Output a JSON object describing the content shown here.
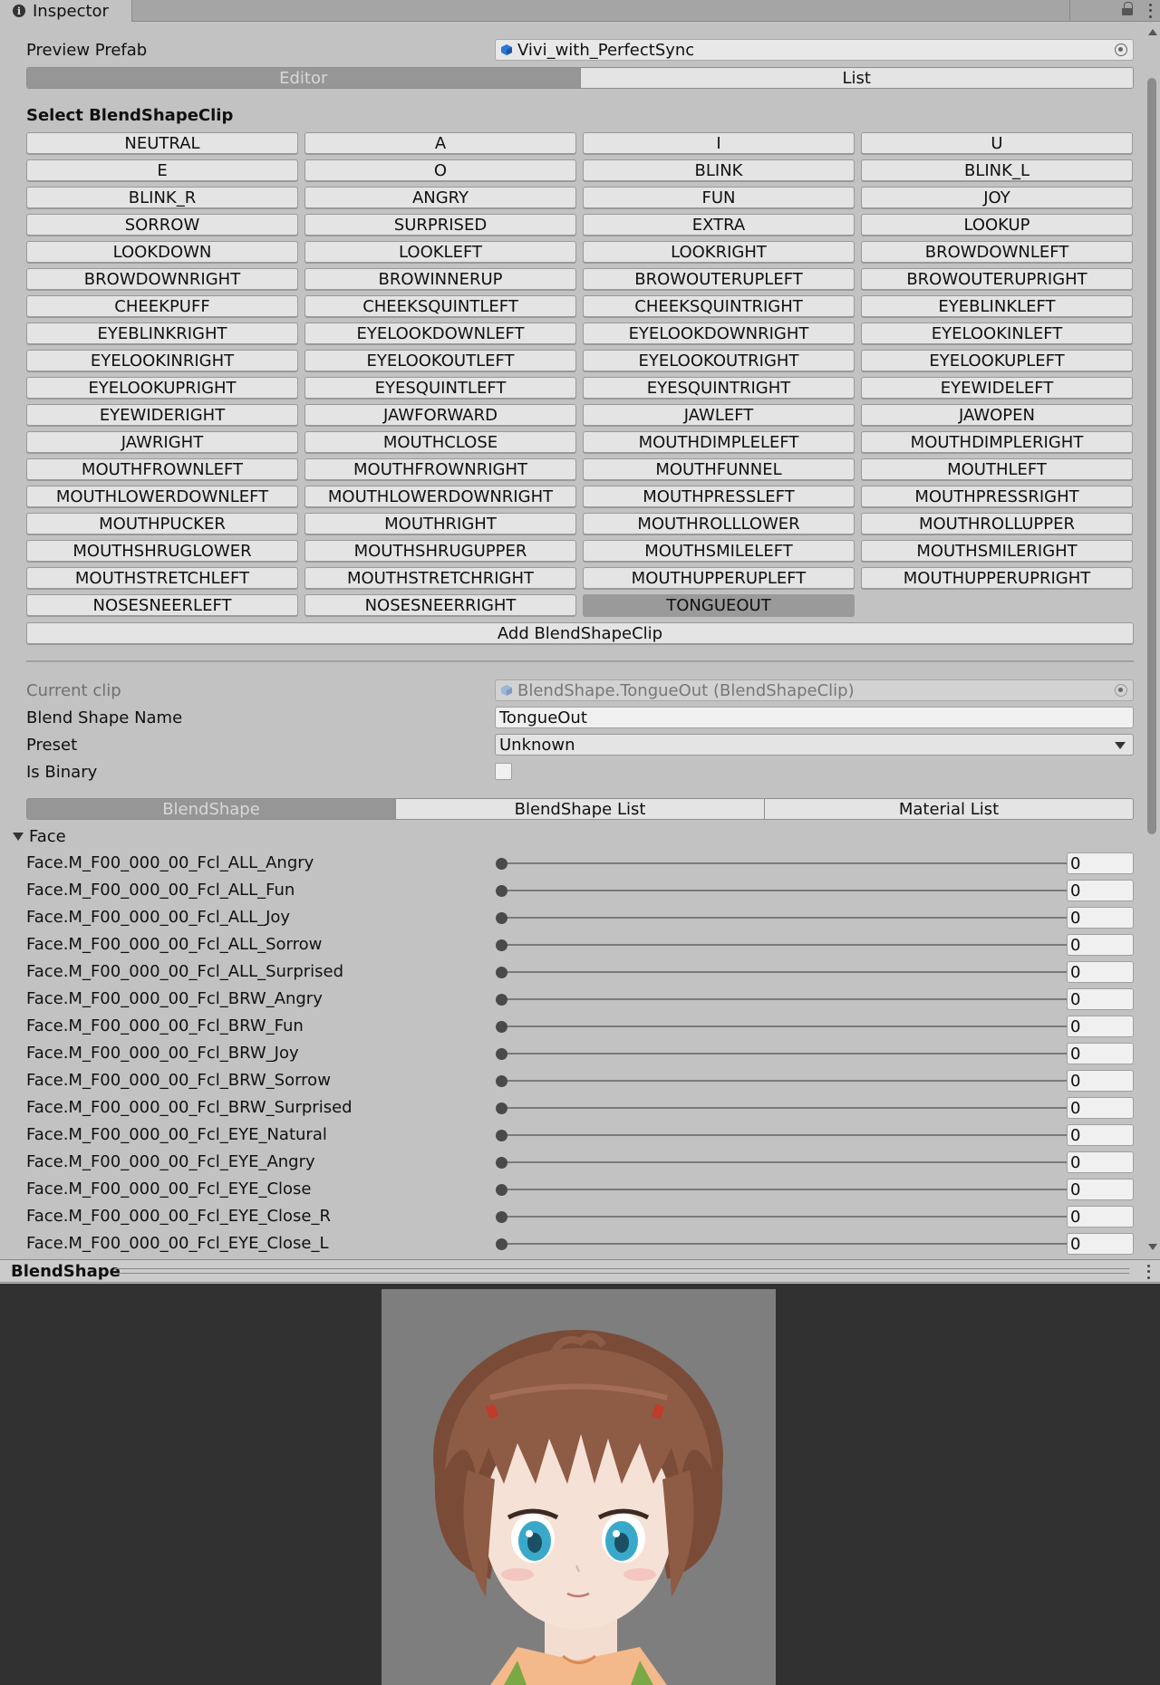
{
  "window": {
    "tab_label": "Inspector",
    "tab_icon": "info-icon"
  },
  "header": {
    "preview_prefab_label": "Preview Prefab",
    "preview_prefab_value": "Vivi_with_PerfectSync",
    "mode_tabs": [
      "Editor",
      "List"
    ],
    "active_mode": "Editor"
  },
  "clips": {
    "title": "Select BlendShapeClip",
    "items": [
      "NEUTRAL",
      "A",
      "I",
      "U",
      "E",
      "O",
      "BLINK",
      "BLINK_L",
      "BLINK_R",
      "ANGRY",
      "FUN",
      "JOY",
      "SORROW",
      "SURPRISED",
      "EXTRA",
      "LOOKUP",
      "LOOKDOWN",
      "LOOKLEFT",
      "LOOKRIGHT",
      "BROWDOWNLEFT",
      "BROWDOWNRIGHT",
      "BROWINNERUP",
      "BROWOUTERUPLEFT",
      "BROWOUTERUPRIGHT",
      "CHEEKPUFF",
      "CHEEKSQUINTLEFT",
      "CHEEKSQUINTRIGHT",
      "EYEBLINKLEFT",
      "EYEBLINKRIGHT",
      "EYELOOKDOWNLEFT",
      "EYELOOKDOWNRIGHT",
      "EYELOOKINLEFT",
      "EYELOOKINRIGHT",
      "EYELOOKOUTLEFT",
      "EYELOOKOUTRIGHT",
      "EYELOOKUPLEFT",
      "EYELOOKUPRIGHT",
      "EYESQUINTLEFT",
      "EYESQUINTRIGHT",
      "EYEWIDELEFT",
      "EYEWIDERIGHT",
      "JAWFORWARD",
      "JAWLEFT",
      "JAWOPEN",
      "JAWRIGHT",
      "MOUTHCLOSE",
      "MOUTHDIMPLELEFT",
      "MOUTHDIMPLERIGHT",
      "MOUTHFROWNLEFT",
      "MOUTHFROWNRIGHT",
      "MOUTHFUNNEL",
      "MOUTHLEFT",
      "MOUTHLOWERDOWNLEFT",
      "MOUTHLOWERDOWNRIGHT",
      "MOUTHPRESSLEFT",
      "MOUTHPRESSRIGHT",
      "MOUTHPUCKER",
      "MOUTHRIGHT",
      "MOUTHROLLLOWER",
      "MOUTHROLLUPPER",
      "MOUTHSHRUGLOWER",
      "MOUTHSHRUGUPPER",
      "MOUTHSMILELEFT",
      "MOUTHSMILERIGHT",
      "MOUTHSTRETCHLEFT",
      "MOUTHSTRETCHRIGHT",
      "MOUTHUPPERUPLEFT",
      "MOUTHUPPERUPRIGHT",
      "NOSESNEERLEFT",
      "NOSESNEERRIGHT",
      "TONGUEOUT"
    ],
    "selected": "TONGUEOUT",
    "add_label": "Add BlendShapeClip"
  },
  "clip_props": {
    "current_clip_label": "Current clip",
    "current_clip_value": "BlendShape.TongueOut (BlendShapeClip)",
    "name_label": "Blend Shape Name",
    "name_value": "TongueOut",
    "preset_label": "Preset",
    "preset_value": "Unknown",
    "is_binary_label": "Is Binary",
    "is_binary": false
  },
  "sub_tabs": {
    "items": [
      "BlendShape",
      "BlendShape List",
      "Material List"
    ],
    "active": "BlendShape"
  },
  "face": {
    "foldout_label": "Face",
    "sliders": [
      {
        "name": "Face.M_F00_000_00_Fcl_ALL_Angry",
        "value": 0
      },
      {
        "name": "Face.M_F00_000_00_Fcl_ALL_Fun",
        "value": 0
      },
      {
        "name": "Face.M_F00_000_00_Fcl_ALL_Joy",
        "value": 0
      },
      {
        "name": "Face.M_F00_000_00_Fcl_ALL_Sorrow",
        "value": 0
      },
      {
        "name": "Face.M_F00_000_00_Fcl_ALL_Surprised",
        "value": 0
      },
      {
        "name": "Face.M_F00_000_00_Fcl_BRW_Angry",
        "value": 0
      },
      {
        "name": "Face.M_F00_000_00_Fcl_BRW_Fun",
        "value": 0
      },
      {
        "name": "Face.M_F00_000_00_Fcl_BRW_Joy",
        "value": 0
      },
      {
        "name": "Face.M_F00_000_00_Fcl_BRW_Sorrow",
        "value": 0
      },
      {
        "name": "Face.M_F00_000_00_Fcl_BRW_Surprised",
        "value": 0
      },
      {
        "name": "Face.M_F00_000_00_Fcl_EYE_Natural",
        "value": 0
      },
      {
        "name": "Face.M_F00_000_00_Fcl_EYE_Angry",
        "value": 0
      },
      {
        "name": "Face.M_F00_000_00_Fcl_EYE_Close",
        "value": 0
      },
      {
        "name": "Face.M_F00_000_00_Fcl_EYE_Close_R",
        "value": 0
      },
      {
        "name": "Face.M_F00_000_00_Fcl_EYE_Close_L",
        "value": 0
      }
    ],
    "slider_max": 100
  },
  "preview": {
    "title": "BlendShape",
    "background_color": "#7e7e7e"
  },
  "colors": {
    "panel_bg": "#c2c2c2",
    "selected_button": "#9a9a9a",
    "viewport_bg": "#313131",
    "hair": "#8a5a44",
    "eye": "#3aa9c9"
  }
}
